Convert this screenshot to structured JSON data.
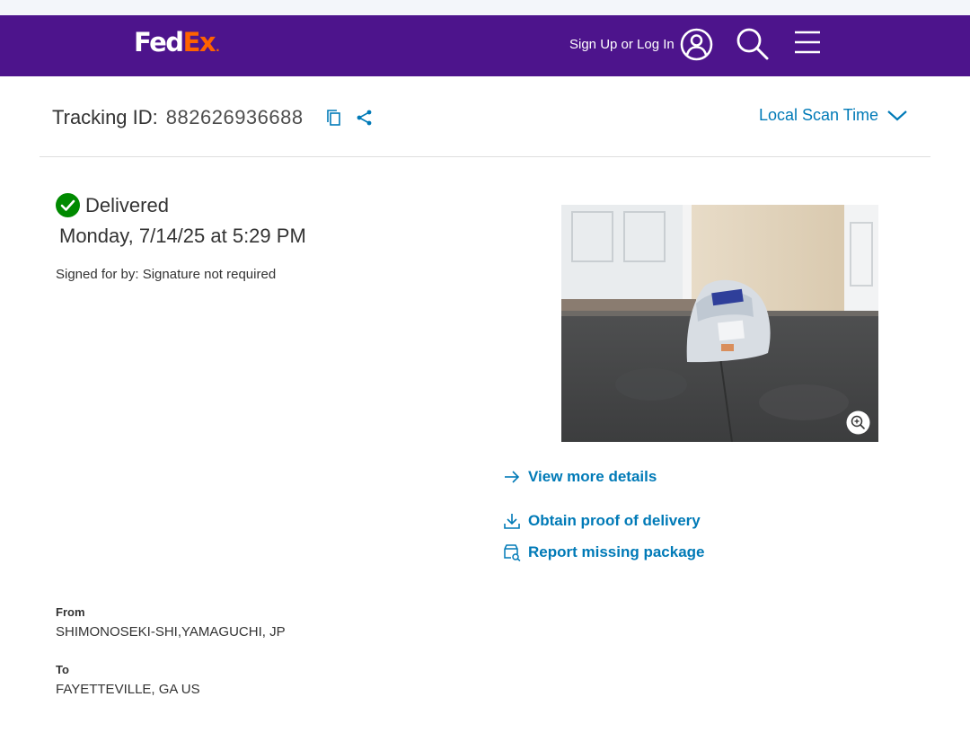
{
  "header": {
    "logo_fed": "Fed",
    "logo_ex": "Ex",
    "logo_dot": ".",
    "signin_label": "Sign Up or Log In",
    "icons": [
      "user-icon",
      "search-icon",
      "menu-icon"
    ],
    "colors": {
      "background": "#4d148c",
      "logo_fed": "#ffffff",
      "logo_ex": "#ff6200"
    }
  },
  "tracking": {
    "label": "Tracking ID:",
    "number": "882626936688",
    "icons": [
      "copy-icon",
      "share-icon"
    ],
    "scan_time_label": "Local Scan Time"
  },
  "status": {
    "text": "Delivered",
    "date": "Monday, 7/14/25 at 5:29 PM",
    "signed_for": "Signed for by: Signature not required",
    "color": "#008a00"
  },
  "links": {
    "view_details": "View more details",
    "proof_of_delivery": "Obtain proof of delivery",
    "report_missing": "Report missing package",
    "color": "#007ab7"
  },
  "addresses": {
    "from_label": "From",
    "from_value": "SHIMONOSEKI-SHI,YAMAGUCHI, JP",
    "to_label": "To",
    "to_value": "FAYETTEVILLE, GA US"
  }
}
